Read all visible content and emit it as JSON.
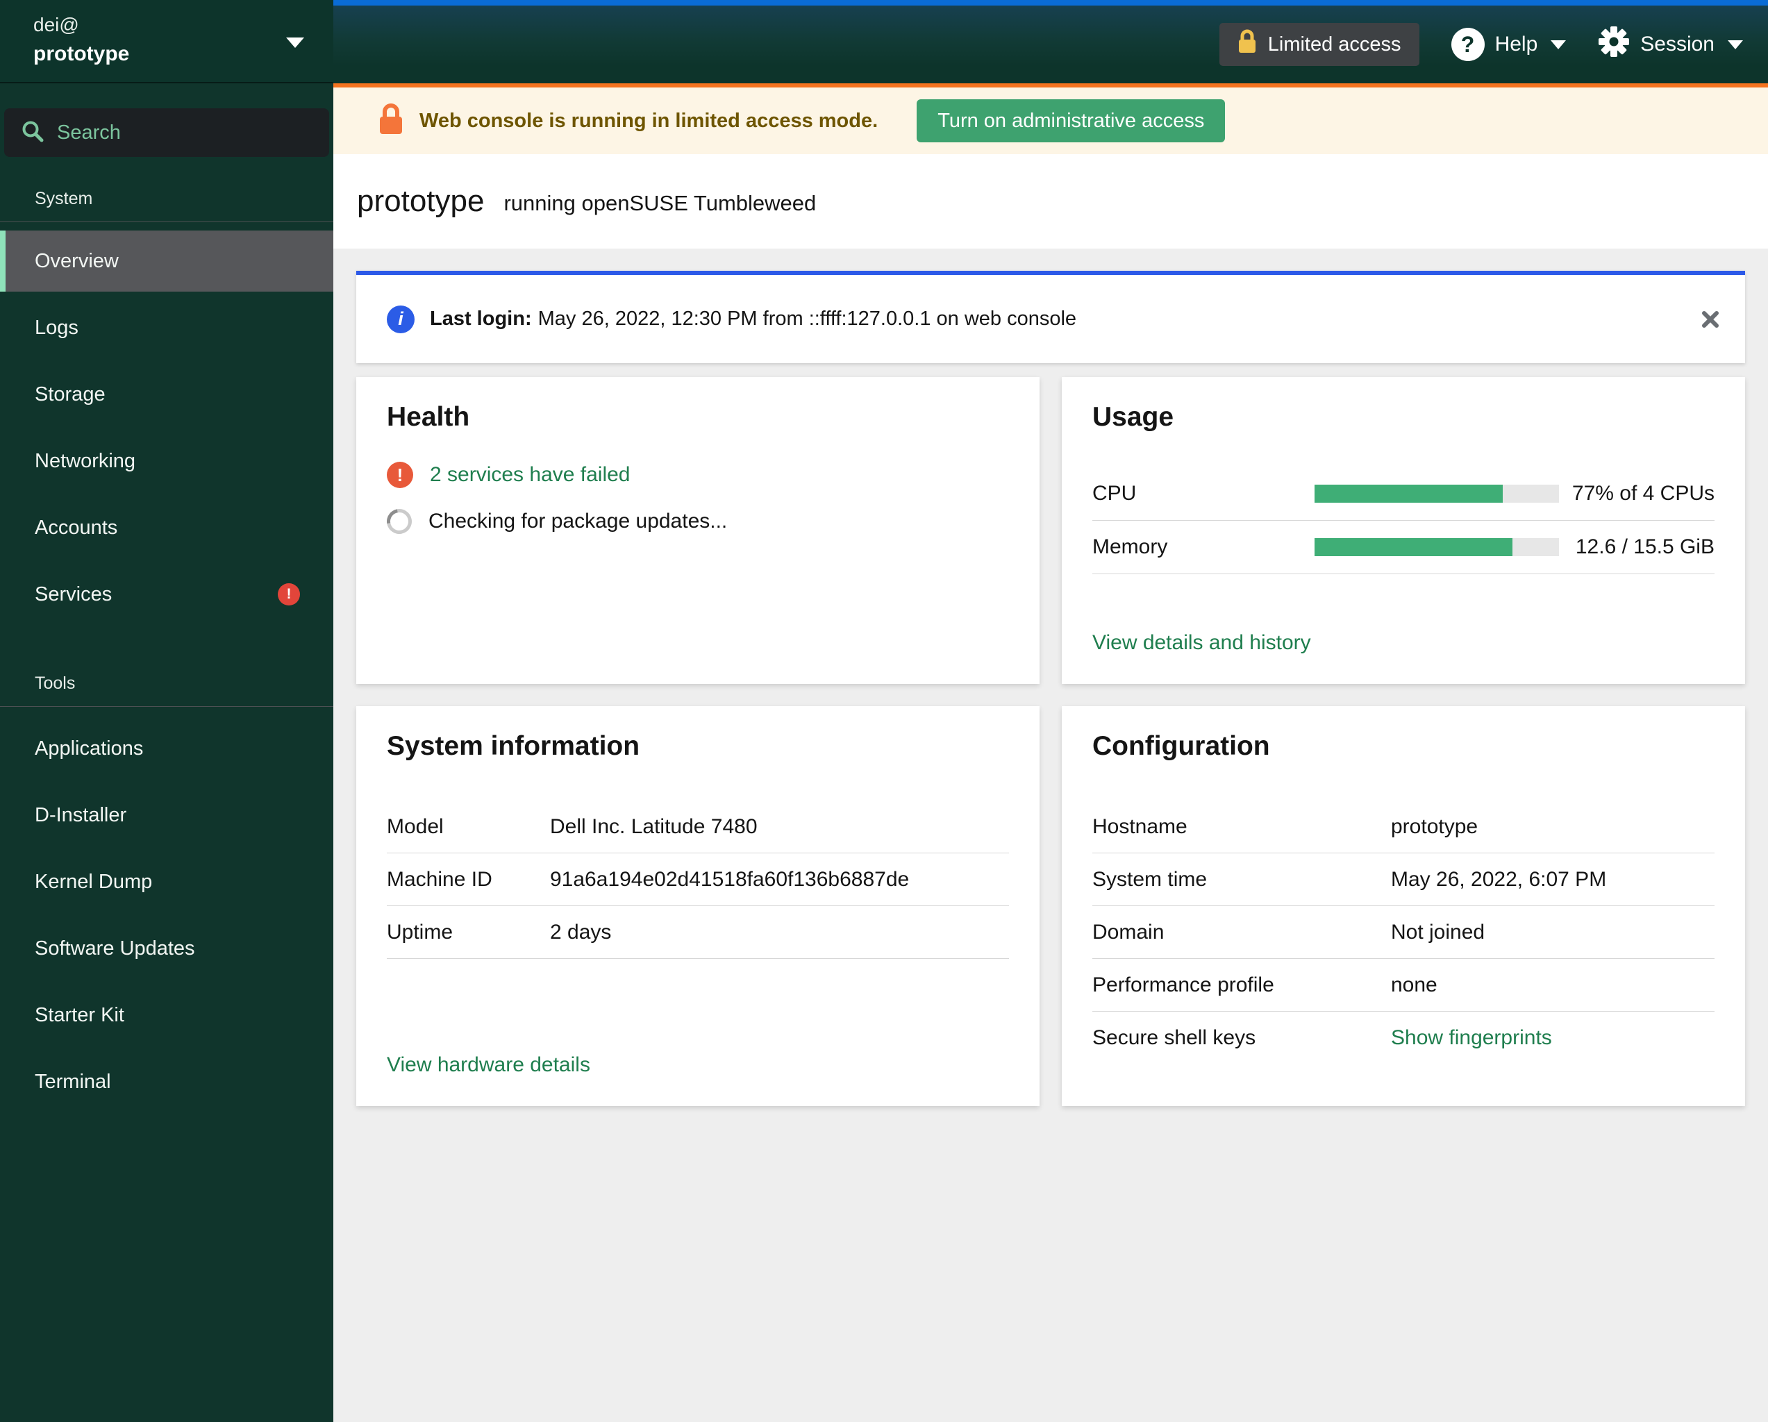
{
  "colors": {
    "blue_stripe": "#0a6cd6",
    "masthead_green": "#0d342b",
    "sidebar_bg": "#10352c",
    "search_bg": "#1c2023",
    "search_accent": "#7cc59e",
    "selected_bg": "#56575a",
    "selected_accent": "#8fe3ba",
    "section_border": "#4c5053",
    "badge_red": "#e2453a",
    "limited_btn_bg": "#3e4144",
    "banner_bg": "#fdf5e5",
    "banner_border": "#f5731f",
    "banner_text": "#6e5500",
    "admin_btn_green": "#3ea26f",
    "alert_blue": "#2c59e8",
    "info_blue": "#2b5ce6",
    "health_warn": "#e8593a",
    "link_green": "#1f7e4e",
    "progress_green": "#3fae76",
    "progress_track": "#e7e7e7",
    "content_bg": "#eeeeee",
    "divider": "#d7d7d7"
  },
  "masthead": {
    "user": "dei@",
    "host": "prototype",
    "limited_access": "Limited access",
    "help": "Help",
    "session": "Session"
  },
  "sidebar": {
    "search_placeholder": "Search",
    "sections": [
      {
        "title": "System",
        "items": [
          {
            "label": "Overview"
          },
          {
            "label": "Logs"
          },
          {
            "label": "Storage"
          },
          {
            "label": "Networking"
          },
          {
            "label": "Accounts"
          },
          {
            "label": "Services",
            "badge": "!"
          }
        ]
      },
      {
        "title": "Tools",
        "items": [
          {
            "label": "Applications"
          },
          {
            "label": "D-Installer"
          },
          {
            "label": "Kernel Dump"
          },
          {
            "label": "Software Updates"
          },
          {
            "label": "Starter Kit"
          },
          {
            "label": "Terminal"
          }
        ]
      }
    ]
  },
  "banner": {
    "message": "Web console is running in limited access mode.",
    "button": "Turn on administrative access"
  },
  "page_header": {
    "title": "prototype",
    "subtitle": "running openSUSE Tumbleweed"
  },
  "alert": {
    "label": "Last login:",
    "text": "May 26, 2022, 12:30 PM from ::ffff:127.0.0.1 on web console"
  },
  "health": {
    "title": "Health",
    "failed_link": "2 services have failed",
    "checking": "Checking for package updates..."
  },
  "usage": {
    "title": "Usage",
    "rows": [
      {
        "label": "CPU",
        "percent": 77,
        "value": "77% of 4 CPUs"
      },
      {
        "label": "Memory",
        "percent": 81,
        "value": "12.6 / 15.5 GiB"
      }
    ],
    "link": "View details and history"
  },
  "system_information": {
    "title": "System information",
    "rows": [
      {
        "label": "Model",
        "value": "Dell Inc. Latitude 7480"
      },
      {
        "label": "Machine ID",
        "value": "91a6a194e02d41518fa60f136b6887de"
      },
      {
        "label": "Uptime",
        "value": "2 days"
      }
    ],
    "link": "View hardware details"
  },
  "configuration": {
    "title": "Configuration",
    "rows": [
      {
        "label": "Hostname",
        "value": "prototype"
      },
      {
        "label": "System time",
        "value": "May 26, 2022, 6:07 PM"
      },
      {
        "label": "Domain",
        "value": "Not joined"
      },
      {
        "label": "Performance profile",
        "value": "none"
      },
      {
        "label": "Secure shell keys",
        "value": "Show fingerprints"
      }
    ]
  }
}
